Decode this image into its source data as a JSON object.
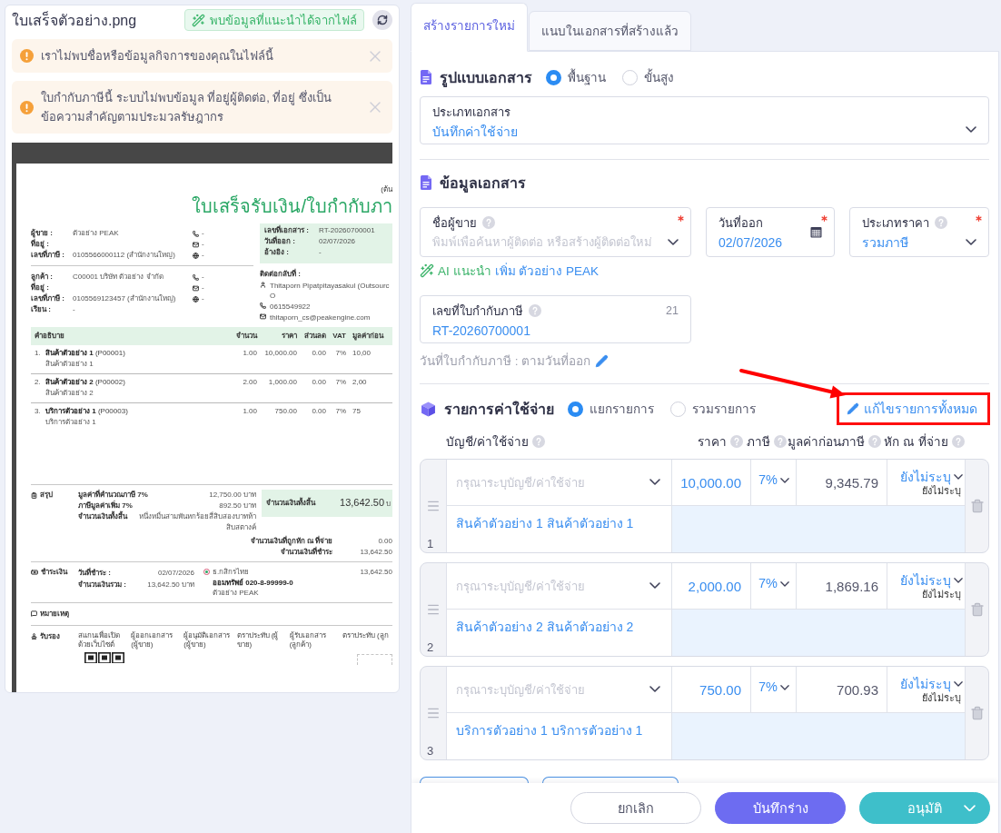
{
  "file_panel": {
    "file_name": "ใบเสร็จตัวอย่าง.png",
    "suggestion_badge": "พบข้อมูลที่แนะนำได้จากไฟล์",
    "alerts": [
      {
        "text": "เราไม่พบชื่อหรือข้อมูลกิจการของคุณในไฟล์นี้"
      },
      {
        "text": "ใบกำกับภาษีนี้ ระบบไม่พบข้อมูล ที่อยู่ผู้ติดต่อ, ที่อยู่ ซึ่งเป็นข้อความสำคัญตามประมวลรัษฎากร"
      }
    ]
  },
  "document_preview": {
    "copy_label": "(ต้น",
    "title": "ใบเสร็จรับเงิน/ใบกำกับภา",
    "seller": {
      "lines": [
        {
          "label": "ผู้ขาย :",
          "value": "ตัวอย่าง PEAK"
        },
        {
          "label": "ที่อยู่ :"
        },
        {
          "label": "เลขที่ภาษี :",
          "value": "0105566000112 (สำนักงานใหญ่)"
        }
      ],
      "contacts": [
        {
          "kind": "phone",
          "value": "-"
        },
        {
          "kind": "email",
          "value": "-"
        },
        {
          "kind": "web",
          "value": "-"
        }
      ]
    },
    "customer": {
      "lines": [
        {
          "label": "ลูกค้า :",
          "value": "C00001 บริษัท ตัวอย่าง จำกัด"
        },
        {
          "label": "ที่อยู่ :"
        },
        {
          "label": "เลขที่ภาษี :",
          "value": "0105569123457 (สำนักงานใหญ่)"
        },
        {
          "label": "เรียน :",
          "value": "-"
        }
      ],
      "contacts": [
        {
          "kind": "phone",
          "value": "-"
        },
        {
          "kind": "email",
          "value": "-"
        },
        {
          "kind": "web",
          "value": "-"
        }
      ]
    },
    "document_meta": [
      {
        "label": "เลขที่เอกสาร :",
        "value": "RT-20260700001"
      },
      {
        "label": "วันที่ออก :",
        "value": "02/07/2026"
      },
      {
        "label": "อ้างอิง :",
        "value": "-"
      }
    ],
    "contact_back": {
      "label": "ติดต่อกลับที่ :",
      "items": [
        {
          "kind": "person",
          "lines": [
            "Thitaporn Pipatpitayasakul (Outsourc",
            "O"
          ]
        },
        {
          "kind": "phone",
          "lines": [
            "0615549922"
          ]
        },
        {
          "kind": "email",
          "lines": [
            "thitaporn_cs@peakengine.com"
          ]
        }
      ]
    },
    "table": {
      "columns": [
        "คำอธิบาย",
        "จำนวน",
        "ราคา",
        "ส่วนลด",
        "VAT",
        "มูลค่าก่อน"
      ],
      "rows": [
        {
          "number": "1.",
          "name": "**สินค้าตัวอย่าง 1** (P00001)",
          "detail": "สินค้าตัวอย่าง 1",
          "quantity": "1.00",
          "price": "10,000.00",
          "discount": "0.00",
          "vat": "7%",
          "amount": "10,00"
        },
        {
          "number": "2.",
          "name": "**สินค้าตัวอย่าง 2** (P00002)",
          "detail": "สินค้าตัวอย่าง 2",
          "quantity": "2.00",
          "price": "1,000.00",
          "discount": "0.00",
          "vat": "7%",
          "amount": "2,00"
        },
        {
          "number": "3.",
          "name": "**บริการตัวอย่าง 1** (P00003)",
          "detail": "บริการตัวอย่าง 1",
          "quantity": "1.00",
          "price": "750.00",
          "discount": "0.00",
          "vat": "7%",
          "amount": "75"
        }
      ]
    },
    "summary": {
      "label": "สรุป",
      "lines": [
        {
          "label": "มูลค่าที่คำนวณภาษี 7%",
          "value": "12,750.00 บาท"
        },
        {
          "label": "ภาษีมูลค่าเพิ่ม 7%",
          "value": "892.50 บาท"
        },
        {
          "label": "จำนวนเงินทั้งสิ้น",
          "value": "หนึ่งหมื่นสามพันหกร้อยสี่สิบสองบาทห้าสิบสตางค์"
        }
      ],
      "total": {
        "label": "จำนวนเงินทั้งสิ้น",
        "value": "13,642.50",
        "unit": "บ"
      },
      "settlement": [
        {
          "label": "จำนวนเงินที่ถูกหัก ณ ที่จ่าย",
          "value": "0.00"
        },
        {
          "label": "จำนวนเงินที่ชำระ",
          "value": "13,642.50"
        }
      ]
    },
    "payment": {
      "label": "ชำระเงิน",
      "lines": [
        {
          "label": "วันที่ชำระ :",
          "value": "02/07/2026"
        },
        {
          "label": "จำนวนเงินรวม :",
          "value": "13,642.50 บาท"
        }
      ],
      "bank": "ธ.กสิกรไทย",
      "account": "ออมทรัพย์ 020-8-99999-0",
      "account_name": "ตัวอย่าง PEAK",
      "amount": "13,642.50"
    },
    "note": {
      "label": "หมายเหตุ"
    },
    "certification": {
      "label": "รับรอง",
      "columns": [
        "สแกนเพื่อเปิดด้วยเว็บไซต์",
        "ผู้ออกเอกสาร (ผู้ขาย)",
        "ผู้อนุมัติเอกสาร (ผู้ขาย)",
        "ตราประทับ (ผู้ขาย)",
        "ผู้รับเอกสาร (ลูกค้า)",
        "ตราประทับ (ลูก"
      ]
    }
  },
  "tabs": [
    {
      "label": "สร้างรายการใหม่",
      "selected": true
    },
    {
      "label": "แนบในเอกสารที่สร้างแล้ว",
      "selected": false
    }
  ],
  "document_format": {
    "title": "รูปแบบเอกสาร",
    "options": [
      {
        "label": "พื้นฐาน",
        "selected": true
      },
      {
        "label": "ขั้นสูง",
        "selected": false
      }
    ]
  },
  "document_type": {
    "label": "ประเภทเอกสาร",
    "value": "บันทึกค่าใช้จ่าย"
  },
  "document_info": {
    "title": "ข้อมูลเอกสาร",
    "fields": [
      {
        "kind": "select",
        "label": "ชื่อผู้ขาย",
        "help": true,
        "required": true,
        "placeholder": "พิมพ์เพื่อค้นหาผู้ติดต่อ หรือสร้างผู้ติดต่อใหม่"
      },
      {
        "kind": "date",
        "label": "วันที่ออก",
        "help": false,
        "required": true,
        "value": "02/07/2026"
      },
      {
        "kind": "select",
        "label": "ประเภทราคา",
        "help": true,
        "required": true,
        "value": "รวมภาษี"
      }
    ],
    "ai_suggestion": {
      "label": "AI แนะนำ",
      "action": "เพิ่ม ตัวอย่าง PEAK"
    },
    "tax_invoice_field": {
      "label": "เลขที่ใบกำกับภาษี",
      "help": true,
      "counter": "21",
      "value": "RT-20260700001"
    },
    "tax_invoice_date": "วันที่ใบกำกับภาษี : ตามวันที่ออก"
  },
  "expense_items": {
    "title": "รายการค่าใช้จ่าย",
    "modes": [
      {
        "label": "แยกรายการ",
        "selected": true
      },
      {
        "label": "รวมรายการ",
        "selected": false
      }
    ],
    "edit_all": "แก้ไขรายการทั้งหมด",
    "columns": [
      {
        "label": "บัญชี/ค่าใช้จ่าย",
        "help": true
      },
      {
        "label": "ราคา",
        "help": true
      },
      {
        "label": "ภาษี",
        "help": true
      },
      {
        "label": "มูลค่าก่อนภาษี",
        "help": true
      },
      {
        "label": "หัก ณ ที่จ่าย",
        "help": true
      }
    ],
    "rows": [
      {
        "number": "1",
        "account_placeholder": "กรุณาระบุบัญชี/ค่าใช้จ่าย",
        "price": "10,000.00",
        "tax": "7%",
        "pre_tax": "9,345.79",
        "withholding": "ยังไม่ระบุ",
        "withholding_note": "ยังไม่ระบุ",
        "description": "สินค้าตัวอย่าง 1 สินค้าตัวอย่าง 1"
      },
      {
        "number": "2",
        "account_placeholder": "กรุณาระบุบัญชี/ค่าใช้จ่าย",
        "price": "2,000.00",
        "tax": "7%",
        "pre_tax": "1,869.16",
        "withholding": "ยังไม่ระบุ",
        "withholding_note": "ยังไม่ระบุ",
        "description": "สินค้าตัวอย่าง 2 สินค้าตัวอย่าง 2"
      },
      {
        "number": "3",
        "account_placeholder": "กรุณาระบุบัญชี/ค่าใช้จ่าย",
        "price": "750.00",
        "tax": "7%",
        "pre_tax": "700.93",
        "withholding": "ยังไม่ระบุ",
        "withholding_note": "ยังไม่ระบุ",
        "description": "บริการตัวอย่าง 1 บริการตัวอย่าง 1"
      }
    ]
  },
  "footer_buttons": [
    {
      "label": "ยกเลิก",
      "kind": "cancel",
      "menu": false
    },
    {
      "label": "บันทึกร่าง",
      "kind": "draft",
      "menu": false
    },
    {
      "label": "อนุมัติ",
      "kind": "approve",
      "menu": true
    }
  ]
}
